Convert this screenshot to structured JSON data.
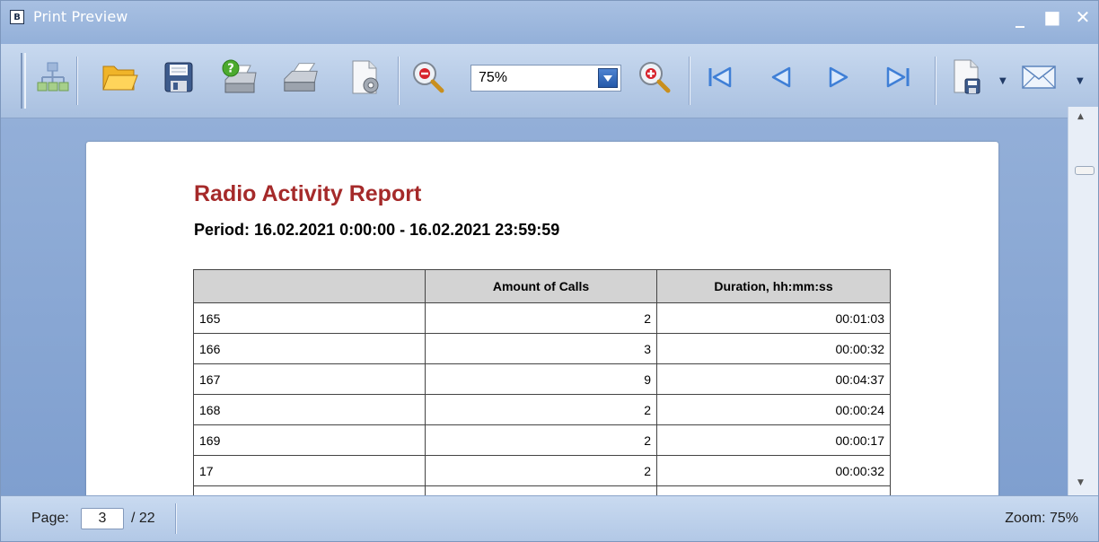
{
  "window": {
    "title": "Print Preview",
    "icon_glyph": "B",
    "minimize_glyph": "_",
    "maximize_glyph": "■",
    "close_glyph": "✕"
  },
  "toolbar": {
    "zoom_value": "75%",
    "icons": [
      "document-map-icon",
      "open-folder-icon",
      "save-icon",
      "print-dialog-icon",
      "quick-print-icon",
      "page-setup-icon",
      "zoom-out-icon",
      "zoom-in-icon",
      "first-page-icon",
      "previous-page-icon",
      "next-page-icon",
      "last-page-icon",
      "export-document-icon",
      "send-email-icon"
    ]
  },
  "report": {
    "title": "Radio Activity Report",
    "period": "Period: 16.02.2021 0:00:00 - 16.02.2021 23:59:59",
    "columns": [
      "",
      "Amount of Calls",
      "Duration, hh:mm:ss"
    ],
    "rows": [
      {
        "id": "165",
        "calls": "2",
        "duration": "00:01:03"
      },
      {
        "id": "166",
        "calls": "3",
        "duration": "00:00:32"
      },
      {
        "id": "167",
        "calls": "9",
        "duration": "00:04:37"
      },
      {
        "id": "168",
        "calls": "2",
        "duration": "00:00:24"
      },
      {
        "id": "169",
        "calls": "2",
        "duration": "00:00:17"
      },
      {
        "id": "17",
        "calls": "2",
        "duration": "00:00:32"
      }
    ]
  },
  "status": {
    "page_label": "Page:",
    "current_page": "3",
    "total_pages": "/ 22",
    "zoom": "Zoom: 75%"
  },
  "colors": {
    "title_red": "#a52a2a",
    "chrome_blue": "#93b0d9"
  }
}
